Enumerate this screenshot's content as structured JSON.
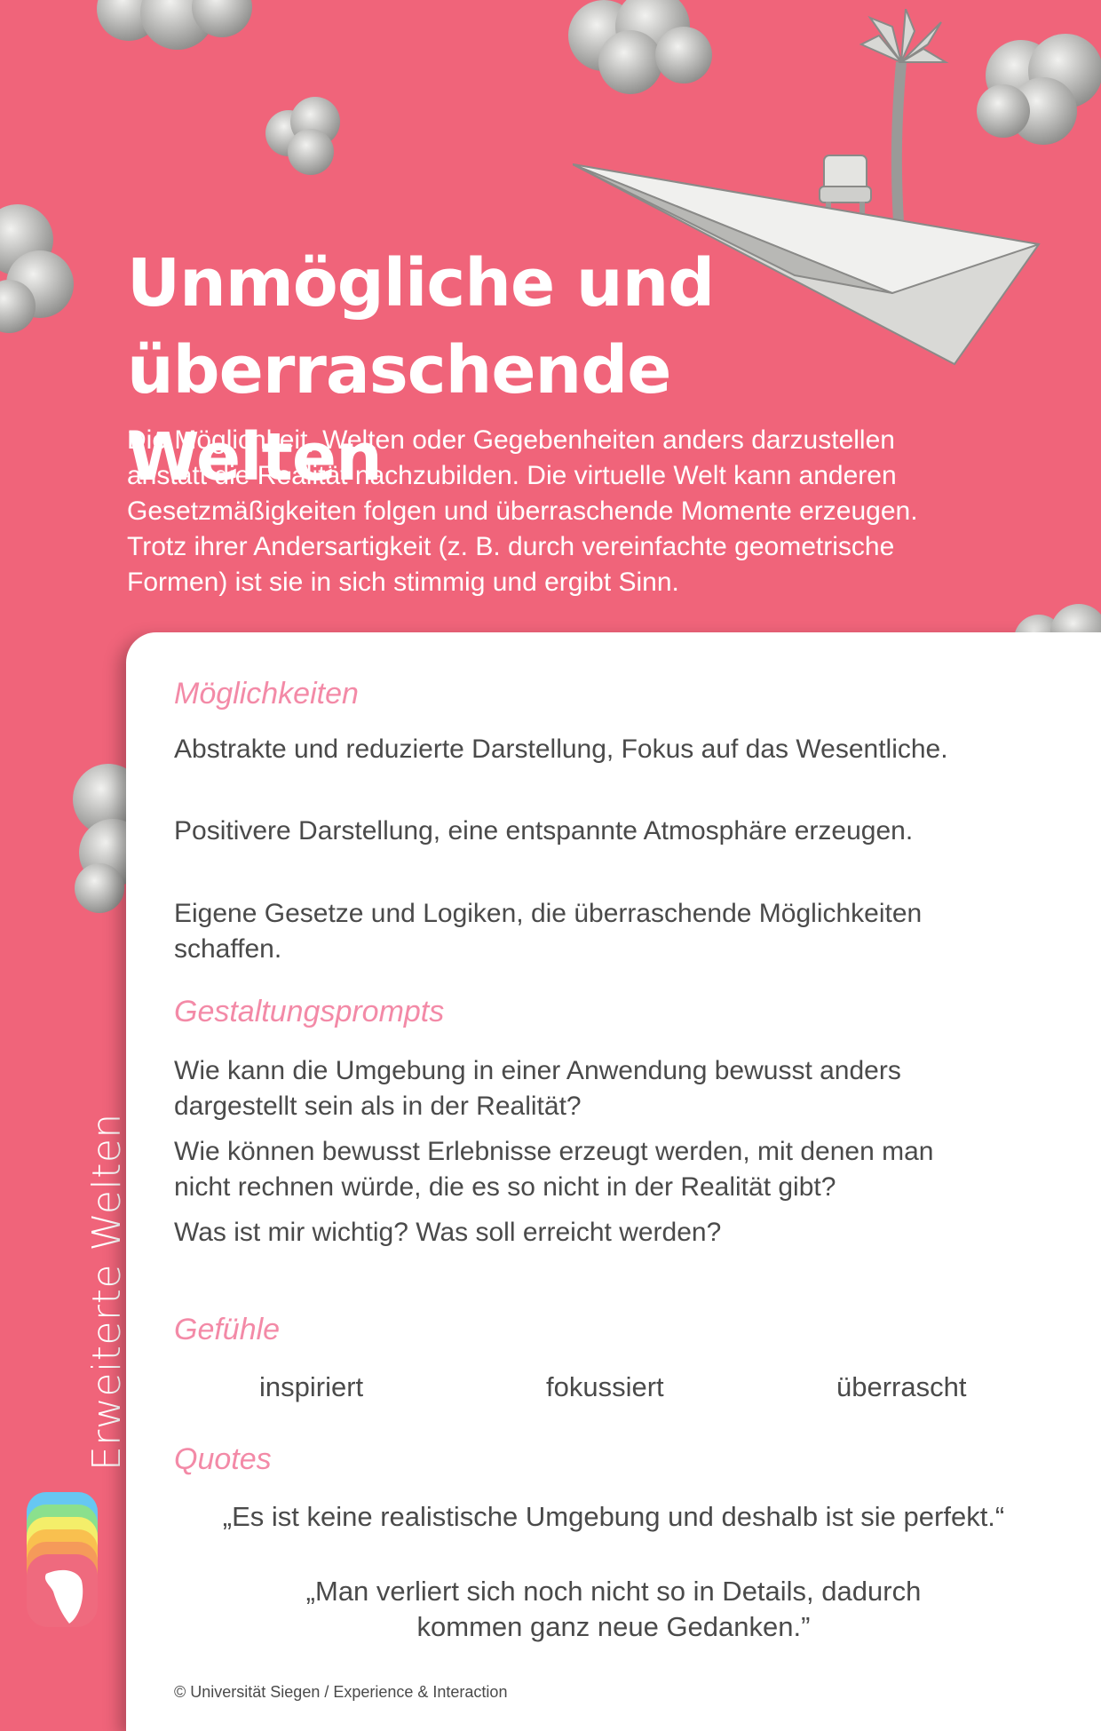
{
  "header": {
    "title_line1": "Unmögliche und",
    "title_line2": "überraschende Welten",
    "intro_lines": [
      "Die Möglichkeit, Welten oder Gegebenheiten anders darzustellen",
      "anstatt die Realität nachzubilden. Die virtuelle Welt kann anderen",
      "Gesetzmäßigkeiten folgen und überraschende Momente erzeugen.",
      "Trotz ihrer Andersartigkeit (z. B. durch vereinfachte geometrische",
      "Formen) ist sie in sich stimmig und ergibt Sinn."
    ]
  },
  "side_label": "Erweiterte Welten",
  "sections": {
    "moeglichkeiten": {
      "heading": "Möglichkeiten",
      "items": [
        "Abstrakte und reduzierte Darstellung, Fokus auf das Wesentliche.",
        "Positivere Darstellung, eine entspannte Atmosphäre erzeugen.",
        "Eigene Gesetze und Logiken, die überraschende Möglichkeiten",
        "schaffen."
      ]
    },
    "prompts": {
      "heading": "Gestaltungsprompts",
      "lines": [
        "Wie kann die Umgebung in einer Anwendung bewusst anders",
        "dargestellt sein als in der Realität?",
        "Wie können bewusst Erlebnisse erzeugt werden, mit denen man",
        "nicht rechnen würde, die es so nicht in der Realität gibt?",
        "Was ist mir wichtig? Was soll erreicht werden?"
      ]
    },
    "gefuehle": {
      "heading": "Gefühle",
      "items": [
        "inspiriert",
        "fokussiert",
        "überrascht"
      ]
    },
    "quotes": {
      "heading": "Quotes",
      "items": [
        "„Es ist keine realistische Umgebung und deshalb ist sie perfekt.“",
        "„Man verliert sich noch nicht so in Details, dadurch",
        "kommen ganz neue Gedanken.”"
      ]
    }
  },
  "footer": {
    "copyright": "© Universität Siegen / Experience & Interaction"
  },
  "colors": {
    "background": "#f0647a",
    "card": "#ffffff",
    "heading_pink": "#f38aa7",
    "body_text": "#4a4a4a",
    "logo_layers": [
      "#66c7f2",
      "#8be08d",
      "#f4ee6a",
      "#f9c04f",
      "#f59a5a",
      "#ef6a7e"
    ]
  },
  "decorations": [
    "cloud-icon",
    "paper-plane-icon",
    "palm-tree-icon",
    "armchair-icon"
  ]
}
